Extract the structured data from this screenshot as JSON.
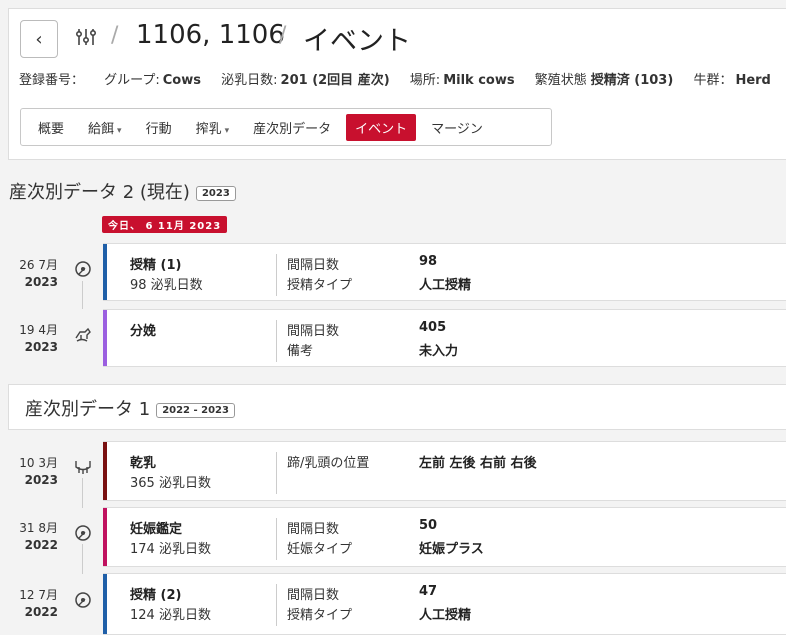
{
  "header": {
    "animal_id": "1106, 1106",
    "separator": "/",
    "title": "イベント",
    "info": {
      "reg_label": "登録番号：",
      "group_label": "グループ:",
      "group_value": "Cows",
      "dim_label": "泌乳日数:",
      "dim_value": "201 (2回目 産次)",
      "location_label": "場所:",
      "location_value": "Milk cows",
      "repro_label": "繁殖状態",
      "repro_value": "授精済 (103)",
      "herd_label": "牛群：",
      "herd_value": "Herd"
    },
    "tabs": [
      {
        "label": "概要",
        "dropdown": false
      },
      {
        "label": "給餌",
        "dropdown": true
      },
      {
        "label": "行動",
        "dropdown": false
      },
      {
        "label": "搾乳",
        "dropdown": true
      },
      {
        "label": "産次別データ",
        "dropdown": false
      },
      {
        "label": "イベント",
        "dropdown": false,
        "active": true
      },
      {
        "label": "マージン",
        "dropdown": false
      }
    ],
    "caret": "▾"
  },
  "today_badge": "今日、 6 11月 2023",
  "lactation2": {
    "title": "産次別データ 2 (現在)",
    "year": "2023",
    "events": [
      {
        "date": "26 7月",
        "year": "2023",
        "icon": "insemination-icon",
        "color": "#1f5fa8",
        "name": "授精 (1)",
        "sub": "98 泌乳日数",
        "label1": "間隔日数",
        "value1": "98",
        "label2": "授精タイプ",
        "value2": "人工授精"
      },
      {
        "date": "19 4月",
        "year": "2023",
        "icon": "calving-icon",
        "color": "#9b5fe0",
        "name": "分娩",
        "sub": "",
        "label1": "間隔日数",
        "value1": "405",
        "label2": "備考",
        "value2": "未入力"
      }
    ]
  },
  "lactation1": {
    "title": "産次別データ 1",
    "year": "2022 - 2023",
    "events": [
      {
        "date": "10 3月",
        "year": "2023",
        "icon": "dry-off-icon",
        "color": "#7a1010",
        "name": "乾乳",
        "sub": "365 泌乳日数",
        "label1": "蹄/乳頭の位置",
        "value1": "左前 左後 右前 右後",
        "label2": "",
        "value2": ""
      },
      {
        "date": "31 8月",
        "year": "2022",
        "icon": "pregnancy-check-icon",
        "color": "#c0125f",
        "name": "妊娠鑑定",
        "sub": "174 泌乳日数",
        "label1": "間隔日数",
        "value1": "50",
        "label2": "妊娠タイプ",
        "value2": "妊娠プラス"
      },
      {
        "date": "12 7月",
        "year": "2022",
        "icon": "insemination-icon",
        "color": "#1f5fa8",
        "name": "授精 (2)",
        "sub": "124 泌乳日数",
        "label1": "間隔日数",
        "value1": "47",
        "label2": "授精タイプ",
        "value2": "人工授精"
      }
    ]
  }
}
